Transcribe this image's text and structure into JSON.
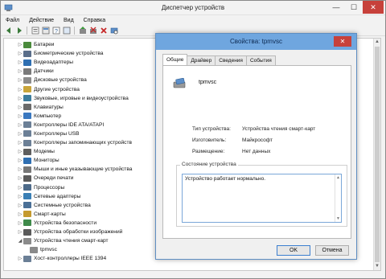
{
  "window": {
    "title": "Диспетчер устройств",
    "minimize_glyph": "—",
    "maximize_glyph": "☐",
    "close_glyph": "✕"
  },
  "menu": [
    "Файл",
    "Действие",
    "Вид",
    "Справка"
  ],
  "tree": {
    "items": [
      {
        "label": "Батареи",
        "icon_color": "#4a8b3c",
        "expander": "▷"
      },
      {
        "label": "Биометрические устройства",
        "icon_color": "#5a6e8a",
        "expander": "▷"
      },
      {
        "label": "Видеоадаптеры",
        "icon_color": "#2f6fb2",
        "expander": "▷"
      },
      {
        "label": "Датчики",
        "icon_color": "#7a7a7a",
        "expander": "▷"
      },
      {
        "label": "Дисковые устройства",
        "icon_color": "#8c8c8c",
        "expander": "▷"
      },
      {
        "label": "Другие устройства",
        "icon_color": "#c9a53a",
        "expander": "▷"
      },
      {
        "label": "Звуковые, игровые и видеоустройства",
        "icon_color": "#3d7d9e",
        "expander": "▷"
      },
      {
        "label": "Клавиатуры",
        "icon_color": "#6a6a6a",
        "expander": "▷"
      },
      {
        "label": "Компьютер",
        "icon_color": "#3a78c0",
        "expander": "▷"
      },
      {
        "label": "Контроллеры IDE ATA/ATAPI",
        "icon_color": "#6b7f96",
        "expander": "▷"
      },
      {
        "label": "Контроллеры USB",
        "icon_color": "#6b7f96",
        "expander": "▷"
      },
      {
        "label": "Контроллеры запоминающих устройств",
        "icon_color": "#6b7f96",
        "expander": "▷"
      },
      {
        "label": "Модемы",
        "icon_color": "#5e5e5e",
        "expander": "▷"
      },
      {
        "label": "Мониторы",
        "icon_color": "#2f6fb2",
        "expander": "▷"
      },
      {
        "label": "Мыши и иные указывающие устройства",
        "icon_color": "#777777",
        "expander": "▷"
      },
      {
        "label": "Очереди печати",
        "icon_color": "#5c5c5c",
        "expander": "▷"
      },
      {
        "label": "Процессоры",
        "icon_color": "#4e6b8a",
        "expander": "▷"
      },
      {
        "label": "Сетевые адаптеры",
        "icon_color": "#3a7fb5",
        "expander": "▷"
      },
      {
        "label": "Системные устройства",
        "icon_color": "#4a6f96",
        "expander": "▷"
      },
      {
        "label": "Смарт-карты",
        "icon_color": "#c59a2e",
        "expander": "▷"
      },
      {
        "label": "Устройства безопасности",
        "icon_color": "#3f8a4a",
        "expander": "▷"
      },
      {
        "label": "Устройства обработки изображений",
        "icon_color": "#5a5a5a",
        "expander": "▷"
      },
      {
        "label": "Устройства чтения смарт-карт",
        "icon_color": "#8a8a8a",
        "expander": "◢"
      },
      {
        "label": "tpmvsc",
        "icon_color": "#8a8a8a",
        "expander": "",
        "child": true
      },
      {
        "label": "Хост-контроллеры IEEE 1394",
        "icon_color": "#6b7f96",
        "expander": "▷"
      }
    ]
  },
  "dialog": {
    "title": "Свойства: tpmvsc",
    "close_glyph": "✕",
    "tabs": [
      "Общие",
      "Драйвер",
      "Сведения",
      "События"
    ],
    "device_name": "tpmvsc",
    "properties": [
      {
        "label": "Тип устройства:",
        "value": "Устройства чтения смарт-карт"
      },
      {
        "label": "Изготовитель:",
        "value": "Майкрософт"
      },
      {
        "label": "Размещение:",
        "value": "Нет данных"
      }
    ],
    "status_legend": "Состояние устройства",
    "status_text": "Устройство работает нормально.",
    "ok_label": "OK",
    "cancel_label": "Отмена"
  }
}
